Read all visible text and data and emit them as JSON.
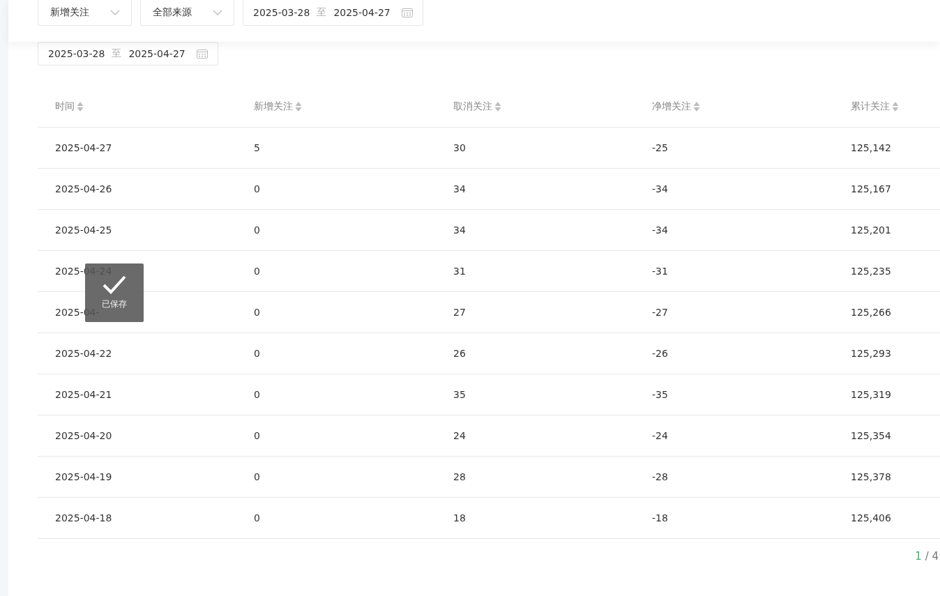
{
  "filters": {
    "selects": [
      "新增关注",
      "全部来源"
    ],
    "date_range": {
      "start": "2025-03-28",
      "separator": "至",
      "end": "2025-04-27"
    }
  },
  "date_range_2": {
    "start": "2025-03-28",
    "separator": "至",
    "end": "2025-04-27"
  },
  "table": {
    "columns": [
      "时间",
      "新增关注",
      "取消关注",
      "净增关注",
      "累计关注"
    ],
    "rows": [
      [
        "2025-04-27",
        "5",
        "30",
        "-25",
        "125,142"
      ],
      [
        "2025-04-26",
        "0",
        "34",
        "-34",
        "125,167"
      ],
      [
        "2025-04-25",
        "0",
        "34",
        "-34",
        "125,201"
      ],
      [
        "2025-04-24",
        "0",
        "31",
        "-31",
        "125,235"
      ],
      [
        "2025-04-",
        "0",
        "27",
        "-27",
        "125,266"
      ],
      [
        "2025-04-22",
        "0",
        "26",
        "-26",
        "125,293"
      ],
      [
        "2025-04-21",
        "0",
        "35",
        "-35",
        "125,319"
      ],
      [
        "2025-04-20",
        "0",
        "24",
        "-24",
        "125,354"
      ],
      [
        "2025-04-19",
        "0",
        "28",
        "-28",
        "125,378"
      ],
      [
        "2025-04-18",
        "0",
        "18",
        "-18",
        "125,406"
      ]
    ]
  },
  "toast": {
    "text": "已保存"
  },
  "pagination": {
    "current": "1",
    "rest": "/ 4"
  }
}
